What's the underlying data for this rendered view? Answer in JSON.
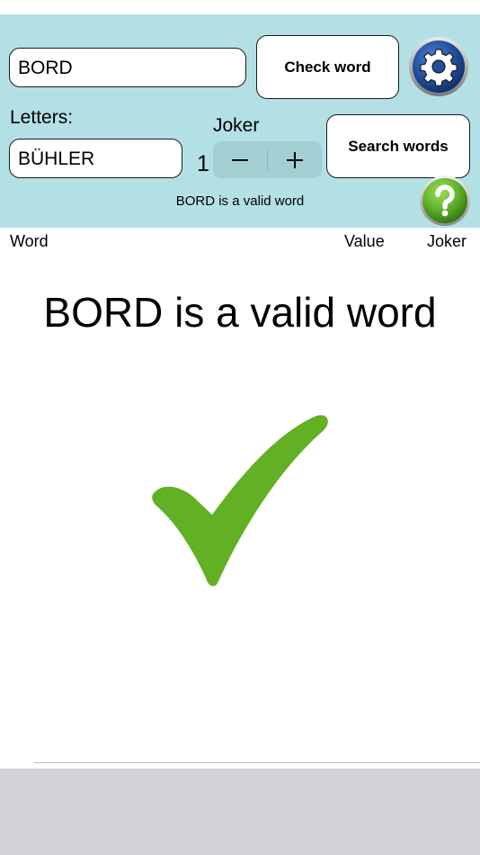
{
  "search": {
    "word_value": "BORD",
    "check_label": "Check word"
  },
  "letters": {
    "label": "Letters:",
    "value": "BÜHLER",
    "search_label": "Search words"
  },
  "joker": {
    "label": "Joker",
    "count": "1",
    "minus": "−",
    "plus": "+"
  },
  "status_message": "BORD is a valid word",
  "columns": {
    "word": "Word",
    "value": "Value",
    "joker": "Joker"
  },
  "result": {
    "heading": "BORD is a valid word",
    "icon": "checkmark-icon",
    "color": "#62b023"
  },
  "icons": {
    "settings": "gear-icon",
    "help": "help-icon"
  },
  "colors": {
    "panel": "#b3e0e4",
    "help_green": "#5fae2a",
    "gear_blue": "#1f4e9c"
  }
}
